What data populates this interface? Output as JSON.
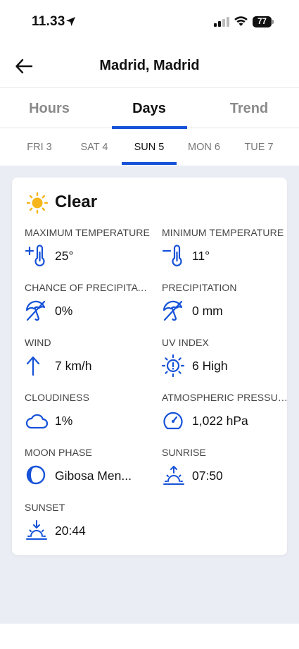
{
  "status": {
    "time": "11.33",
    "battery": "77"
  },
  "header": {
    "title": "Madrid, Madrid"
  },
  "tabs": [
    {
      "label": "Hours"
    },
    {
      "label": "Days"
    },
    {
      "label": "Trend"
    }
  ],
  "active_tab": "Days",
  "days": [
    {
      "label": "FRI 3"
    },
    {
      "label": "SAT 4"
    },
    {
      "label": "SUN 5"
    },
    {
      "label": "MON 6"
    },
    {
      "label": "TUE 7"
    }
  ],
  "active_day": "SUN 5",
  "card": {
    "condition": "Clear",
    "condition_icon": "sun-icon",
    "items": [
      {
        "label": "MAXIMUM TEMPERATURE",
        "value": "25°",
        "icon": "thermometer-plus-icon"
      },
      {
        "label": "MINIMUM TEMPERATURE",
        "value": "11°",
        "icon": "thermometer-minus-icon"
      },
      {
        "label": "CHANCE OF PRECIPITATI...",
        "value": "0%",
        "icon": "umbrella-off-icon"
      },
      {
        "label": "PRECIPITATION",
        "value": "0 mm",
        "icon": "umbrella-off-icon"
      },
      {
        "label": "WIND",
        "value": "7 km/h",
        "icon": "wind-arrow-icon"
      },
      {
        "label": "UV INDEX",
        "value": "6 High",
        "icon": "uv-index-icon"
      },
      {
        "label": "CLOUDINESS",
        "value": "1%",
        "icon": "cloud-icon"
      },
      {
        "label": "ATMOSPHERIC PRESSURE",
        "value": "1,022 hPa",
        "icon": "pressure-gauge-icon"
      },
      {
        "label": "MOON PHASE",
        "value": "Gibosa Men...",
        "icon": "moon-phase-icon"
      },
      {
        "label": "SUNRISE",
        "value": "07:50",
        "icon": "sunrise-icon"
      },
      {
        "label": "SUNSET",
        "value": "20:44",
        "icon": "sunset-icon"
      }
    ]
  },
  "colors": {
    "accent": "#1652d8",
    "sun": "#f5b51b",
    "background": "#ebedf4"
  }
}
